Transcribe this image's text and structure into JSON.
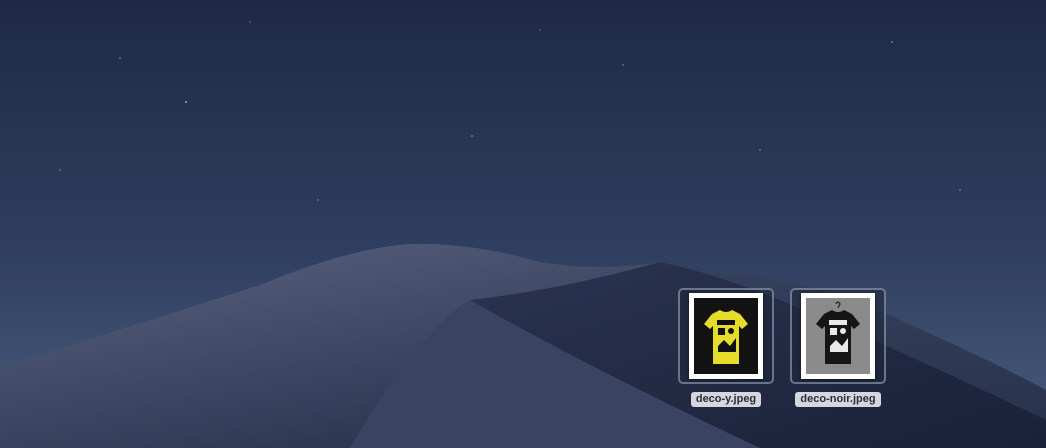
{
  "desktop": {
    "wallpaper": "night-dune-icon",
    "colors": {
      "sky_top": "#1e2a45",
      "sky_horizon": "#4a5c7e",
      "dune_light": "#4b5674",
      "dune_shadow": "#1f2740",
      "selection_border": "#aab4c8",
      "label_bg": "#d5d7dc"
    },
    "files": [
      {
        "name": "deco-y.jpeg",
        "thumbnail": "yellow-tshirt-icon",
        "shirt_color": "#e6dc2a",
        "selected": true
      },
      {
        "name": "deco-noir.jpeg",
        "thumbnail": "black-tshirt-icon",
        "shirt_color": "#151515",
        "selected": true
      }
    ]
  }
}
